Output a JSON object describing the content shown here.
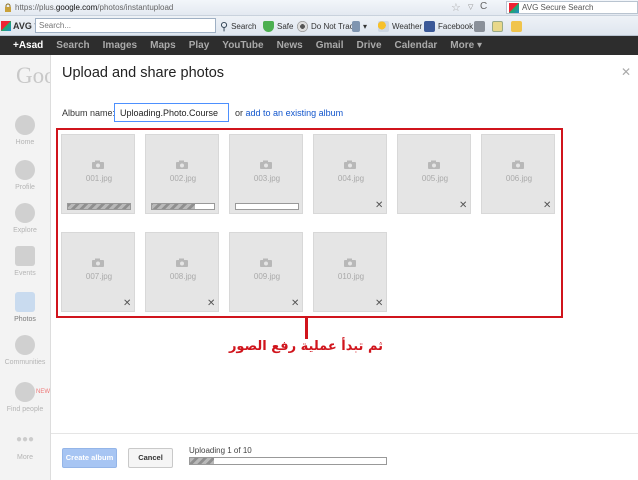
{
  "browser": {
    "url_prefix": "https://plus.",
    "url_domain": "google.com",
    "url_path": "/photos/instantupload",
    "search_engine": "AVG Secure Search"
  },
  "toolbar": {
    "brand": "AVG",
    "search_placeholder": "Search...",
    "search_label": "Search",
    "safe_label": "Safe",
    "dnt_label": "Do Not Track",
    "weather_label": "Weather",
    "facebook_label": "Facebook"
  },
  "gbar": {
    "user": "+Asad",
    "items": [
      "Search",
      "Images",
      "Maps",
      "Play",
      "YouTube",
      "News",
      "Gmail",
      "Drive",
      "Calendar",
      "More ▾"
    ]
  },
  "rail": {
    "items": [
      {
        "label": "Home"
      },
      {
        "label": "Profile"
      },
      {
        "label": "Explore"
      },
      {
        "label": "Events"
      },
      {
        "label": "Photos"
      },
      {
        "label": "Communities"
      },
      {
        "label": "Find people",
        "badge": "NEW"
      },
      {
        "label": "More"
      }
    ]
  },
  "dialog": {
    "title": "Upload and share photos",
    "album_label": "Album name:",
    "album_value": "Uploading.Photo.Course",
    "or_text": "or",
    "add_existing_link": "add to an existing album"
  },
  "photos": [
    {
      "name": "001.jpg",
      "progress": 1.0,
      "state": "uploading"
    },
    {
      "name": "002.jpg",
      "progress": 0.7,
      "state": "uploading"
    },
    {
      "name": "003.jpg",
      "progress": 0.0,
      "state": "uploading"
    },
    {
      "name": "004.jpg",
      "state": "queued"
    },
    {
      "name": "005.jpg",
      "state": "queued"
    },
    {
      "name": "006.jpg",
      "state": "queued"
    },
    {
      "name": "007.jpg",
      "state": "queued"
    },
    {
      "name": "008.jpg",
      "state": "queued"
    },
    {
      "name": "009.jpg",
      "state": "queued"
    },
    {
      "name": "010.jpg",
      "state": "queued"
    }
  ],
  "annotation": {
    "arabic_text": "ثم تبدأ عملية رفع الصور",
    "color": "#d0141c"
  },
  "footer": {
    "create_label": "Create album",
    "cancel_label": "Cancel",
    "status_text": "Uploading 1 of 10",
    "overall_progress": 0.12
  },
  "colors": {
    "accent_blue": "#4d90fe",
    "link": "#15c",
    "highlight_red": "#d0141c",
    "gbar_bg": "#2d2d2d"
  }
}
